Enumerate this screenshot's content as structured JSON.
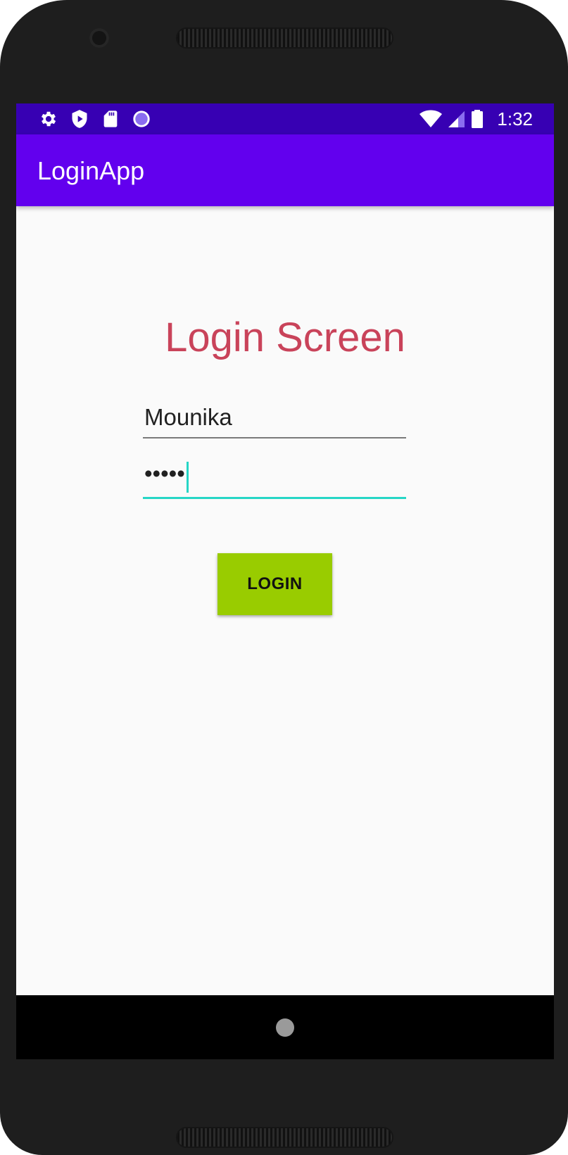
{
  "status_bar": {
    "left_icons": [
      "gear-icon",
      "play-shield-icon",
      "sd-card-icon",
      "sync-circle-icon"
    ],
    "right_icons": [
      "wifi-icon",
      "signal-icon",
      "battery-icon"
    ],
    "time": "1:32"
  },
  "app_bar": {
    "title": "LoginApp",
    "color": "#6200ee",
    "status_color": "#3700b3"
  },
  "form": {
    "heading": "Login Screen",
    "heading_color": "#c9435a",
    "username_value": "Mounika",
    "password_value": "•••••",
    "login_label": "LOGIN",
    "login_button_color": "#99cc00",
    "focus_color": "#26d6c6"
  },
  "nav_bar": {
    "icons": [
      "home-icon"
    ]
  }
}
